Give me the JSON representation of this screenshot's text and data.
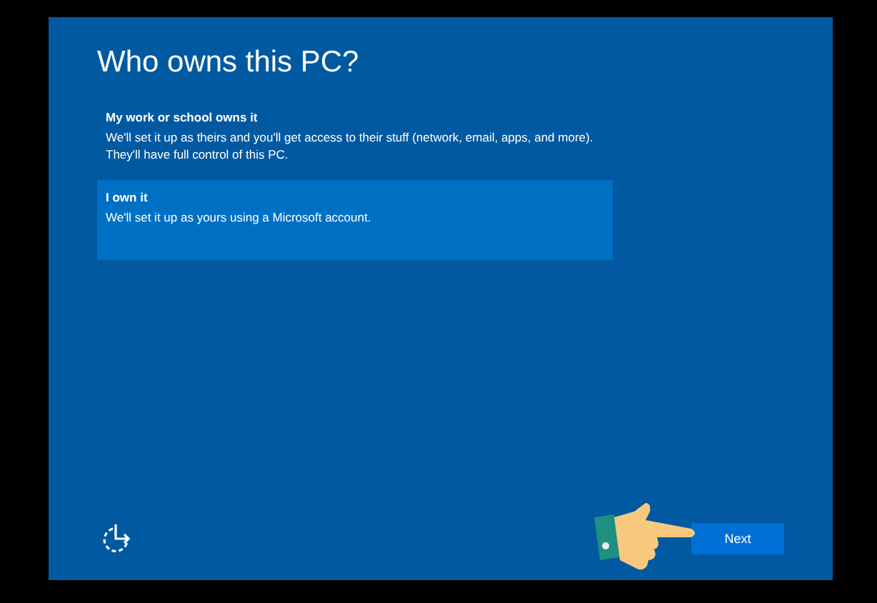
{
  "title": "Who owns this PC?",
  "options": [
    {
      "label": "My work or school owns it",
      "description": "We'll set it up as theirs and you'll get access to their stuff (network, email, apps, and more). They'll have full control of this PC.",
      "selected": false
    },
    {
      "label": "I own it",
      "description": "We'll set it up as yours using a Microsoft account.",
      "selected": true
    }
  ],
  "next_button": "Next"
}
